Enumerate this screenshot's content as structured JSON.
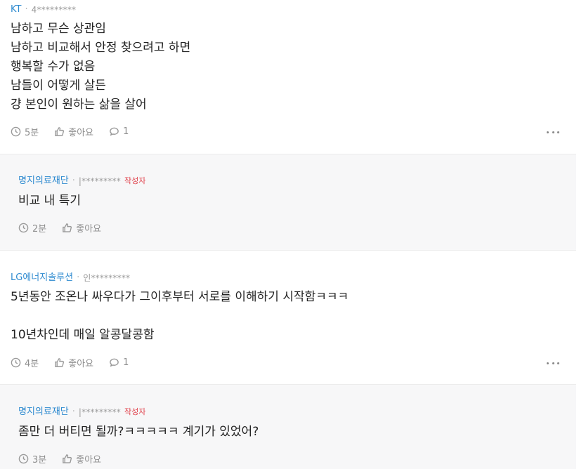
{
  "comments": [
    {
      "company": "KT",
      "user": "4*********",
      "text": "남하고 무슨 상관임\n남하고 비교해서 안정 찾으려고 하면\n행복할 수가 없음\n남들이 어떻게 살든\n걍 본인이 원하는 삶을 살어",
      "time": "5분",
      "like_label": "좋아요",
      "reply_count": "1"
    },
    {
      "company": "명지의료재단",
      "user": "|*********",
      "badge": "작성자",
      "text": "비교 내 특기",
      "time": "2분",
      "like_label": "좋아요"
    },
    {
      "company": "LG에너지솔루션",
      "user": "인*********",
      "text": "5년동안 조온나 싸우다가 그이후부터 서로를 이해하기 시작함ㅋㅋㅋ\n\n10년차인데 매일 알콩달콩함",
      "time": "4분",
      "like_label": "좋아요",
      "reply_count": "1"
    },
    {
      "company": "명지의료재단",
      "user": "|*********",
      "badge": "작성자",
      "text": "좀만 더 버티면 될까?ㅋㅋㅋㅋㅋ 계기가 있었어?",
      "time": "3분",
      "like_label": "좋아요"
    }
  ],
  "icons": {
    "time": "clock-icon",
    "like": "thumbs-up-icon",
    "reply": "speech-bubble-icon",
    "more": "more-dots-icon"
  },
  "colors": {
    "company": "#2f8bd0",
    "author_badge": "#e0404a",
    "reply_background": "#f7f7f8",
    "muted": "#8e8e8e"
  }
}
